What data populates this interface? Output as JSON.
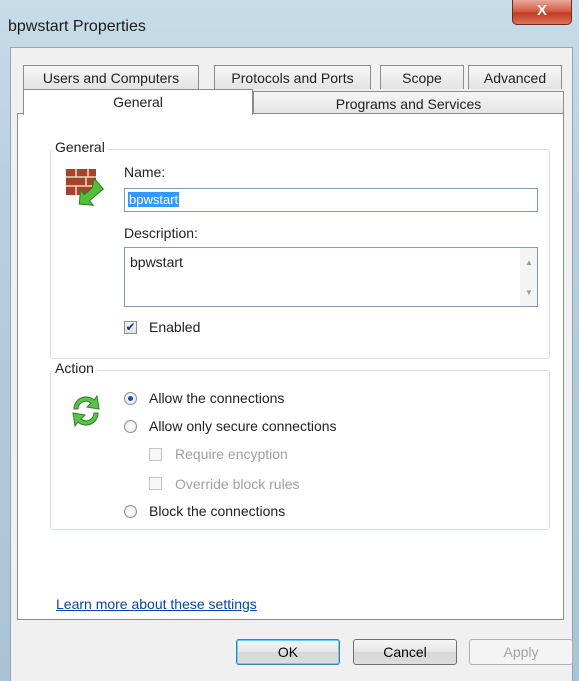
{
  "window": {
    "title": "bpwstart Properties",
    "close_glyph": "X"
  },
  "tabs_back": [
    {
      "label": "Users and Computers"
    },
    {
      "label": "Protocols and Ports"
    },
    {
      "label": "Scope"
    },
    {
      "label": "Advanced"
    }
  ],
  "tabs_front": [
    {
      "label": "General",
      "active": true
    },
    {
      "label": "Programs and Services",
      "active": false
    }
  ],
  "general_group": {
    "legend": "General",
    "icon": "firewall-rule-icon",
    "name_label": "Name:",
    "name_value": "bpwstart",
    "description_label": "Description:",
    "description_value": "bpwstart",
    "enabled_label": "Enabled",
    "enabled_checked": true
  },
  "action_group": {
    "legend": "Action",
    "icon": "action-arrows-icon",
    "options": [
      {
        "label": "Allow the connections",
        "checked": true
      },
      {
        "label": "Allow only secure connections",
        "checked": false
      },
      {
        "label": "Block the connections",
        "checked": false
      }
    ],
    "sub_options": [
      {
        "label": "Require encyption",
        "checked": false,
        "disabled": true
      },
      {
        "label": "Override block rules",
        "checked": false,
        "disabled": true
      }
    ]
  },
  "learn_more_link": "Learn more about these settings",
  "buttons": {
    "ok": "OK",
    "cancel": "Cancel",
    "apply": "Apply"
  },
  "colors": {
    "selection": "#3399ff",
    "link": "#0645ad",
    "close": "#c23a20"
  }
}
